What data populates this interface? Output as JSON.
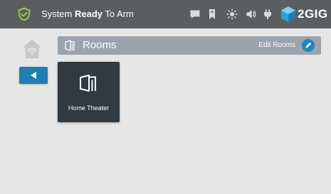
{
  "status_bar": {
    "status_prefix": "System",
    "status_bold": "Ready",
    "status_suffix": "To Arm",
    "brand": "2GIG",
    "icons": [
      "shield-check-icon",
      "message-icon",
      "bookmark-icon",
      "brightness-icon",
      "volume-icon",
      "plug-icon",
      "2gig-logo"
    ]
  },
  "sidebar": {
    "icons": [
      "home-wifi-icon",
      "back-arrow-icon"
    ]
  },
  "header": {
    "title": "Rooms",
    "edit_label": "Edit Rooms"
  },
  "rooms": [
    {
      "label": "Home Theater",
      "icon": "room-door-icon"
    }
  ],
  "colors": {
    "topbar": "#5b5e61",
    "accent": "#1f7fb0",
    "header": "#9ba3ac",
    "tile": "#2f3a43",
    "background": "#e6e6e6",
    "shield": "#9dd13c"
  }
}
